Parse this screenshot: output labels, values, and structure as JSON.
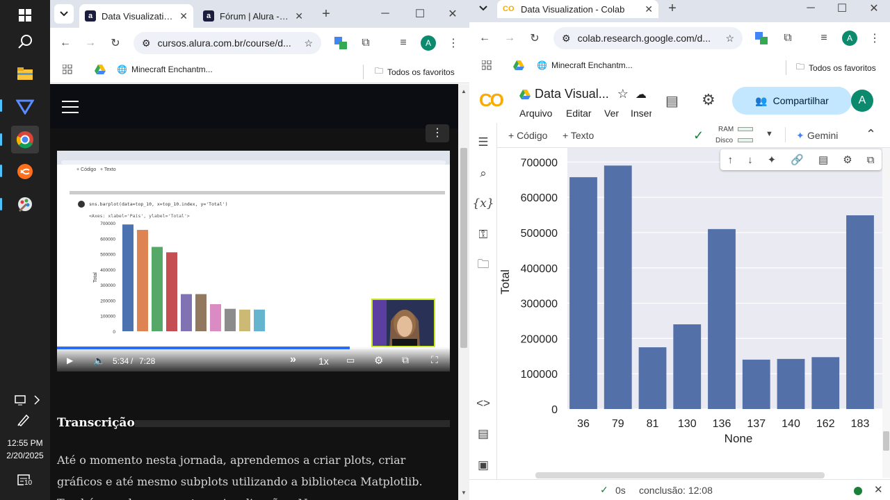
{
  "taskbar": {
    "time": "12:55 PM",
    "date": "2/20/2025",
    "notif_count": "10"
  },
  "left": {
    "tabs": [
      {
        "label": "Data Visualization:"
      },
      {
        "label": "Fórum | Alura - Cur"
      }
    ],
    "url": "cursos.alura.com.br/course/d...",
    "bookmarks": {
      "item": "Minecraft Enchantm...",
      "all": "Todos os favoritos"
    },
    "avatar": "A",
    "video": {
      "time_current": "5:34",
      "time_sep": "/",
      "time_total": "7:28",
      "speed": "1x",
      "progress": 0.745,
      "code": "sns.barplot(data=top_10, x=top_10.index, y='Total')",
      "output": "<Axes: xlabel='País', ylabel='Total'>",
      "mini_menu": [
        "+ Código",
        "+ Texto"
      ],
      "mini_yticks": [
        "700000",
        "600000",
        "500000",
        "400000",
        "300000",
        "200000",
        "100000",
        "0"
      ],
      "mini_ylabel": "Total"
    },
    "transcript": {
      "title": "Transcrição",
      "text": "Até o momento nesta jornada, aprendemos a criar plots, criar gráficos e até mesmo subplots utilizando a biblioteca Matplotlib. Também exploramos outras visualizações. No"
    }
  },
  "right": {
    "tab": "Data Visualization - Colab",
    "url": "colab.research.google.com/d...",
    "bookmarks": {
      "item": "Minecraft Enchantm...",
      "all": "Todos os favoritos"
    },
    "avatar": "A",
    "notebook_title": "Data Visual...",
    "menu": [
      "Arquivo",
      "Editar",
      "Ver",
      "Inser"
    ],
    "share": "Compartilhar",
    "cell_bar": {
      "code": "+ Código",
      "text": "+ Texto",
      "ram": "RAM",
      "disk": "Disco",
      "gemini": "Gemini"
    },
    "status": {
      "check": "0s",
      "done": "conclusão: 12:08"
    }
  },
  "chart_data": {
    "type": "bar",
    "categories": [
      "36",
      "79",
      "81",
      "130",
      "136",
      "137",
      "140",
      "162",
      "183"
    ],
    "values": [
      657000,
      690000,
      175000,
      240000,
      510000,
      140000,
      142000,
      147000,
      549000
    ],
    "ylabel": "Total",
    "xlabel": "None",
    "yticks": [
      "700000",
      "600000",
      "500000",
      "400000",
      "300000",
      "200000",
      "100000",
      "0"
    ],
    "ylim": [
      0,
      740000
    ],
    "color": "#5470a8",
    "background": "#eaeaf2",
    "grid": true
  }
}
